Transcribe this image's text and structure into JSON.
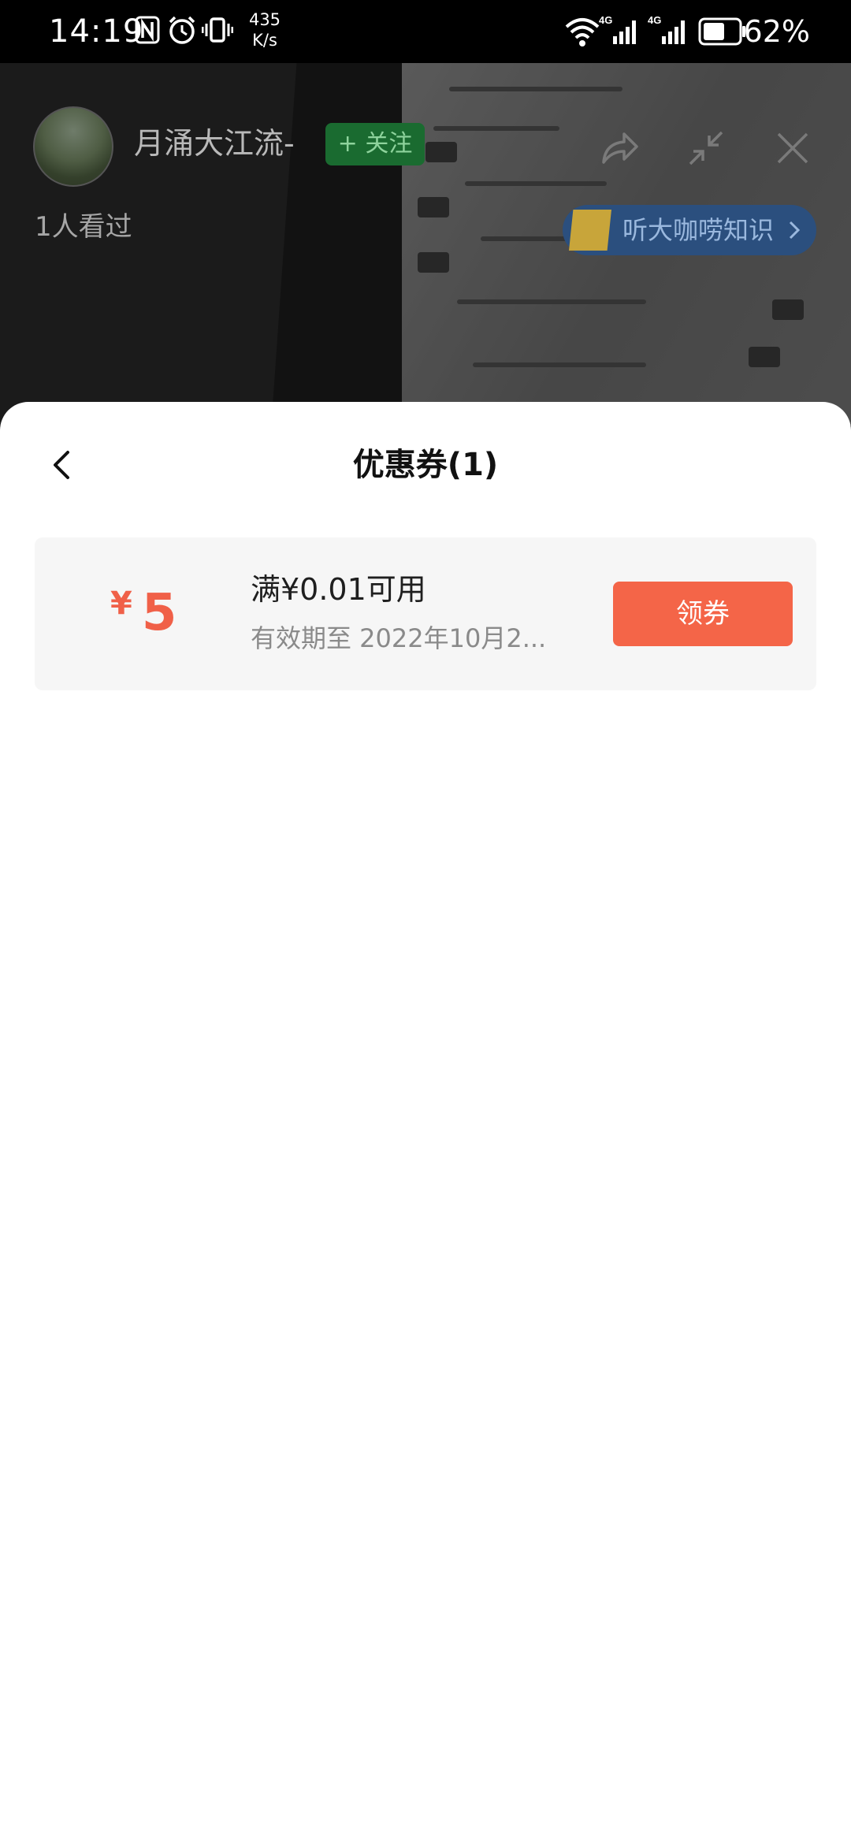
{
  "status_bar": {
    "time": "14:19",
    "net_speed_value": "435",
    "net_speed_unit": "K/s",
    "network_type_1": "4G",
    "network_type_2": "4G",
    "battery_percent": "62%",
    "battery_level": 0.62,
    "icons": [
      "nfc-icon",
      "alarm-icon",
      "vibrate-icon",
      "wifi-icon",
      "signal-icon",
      "signal-icon",
      "battery-icon"
    ]
  },
  "live_room": {
    "host_name": "月涌大江流-",
    "follow_label": "+ 关注",
    "viewers_text": "1人看过",
    "promo_label": "听大咖唠知识",
    "icons": [
      "share-icon",
      "minimize-icon",
      "close-icon"
    ]
  },
  "sheet": {
    "title": "优惠券(1)",
    "back_icon": "chevron-left-icon"
  },
  "coupons": [
    {
      "currency": "¥",
      "amount": "5",
      "condition": "满¥0.01可用",
      "validity": "有效期至 2022年10月2...",
      "claim_label": "领券"
    }
  ],
  "colors": {
    "accent": "#f46548",
    "amount": "#f06048",
    "follow_bg": "#1a6b30",
    "promo_bg": "#2b4f7e"
  }
}
